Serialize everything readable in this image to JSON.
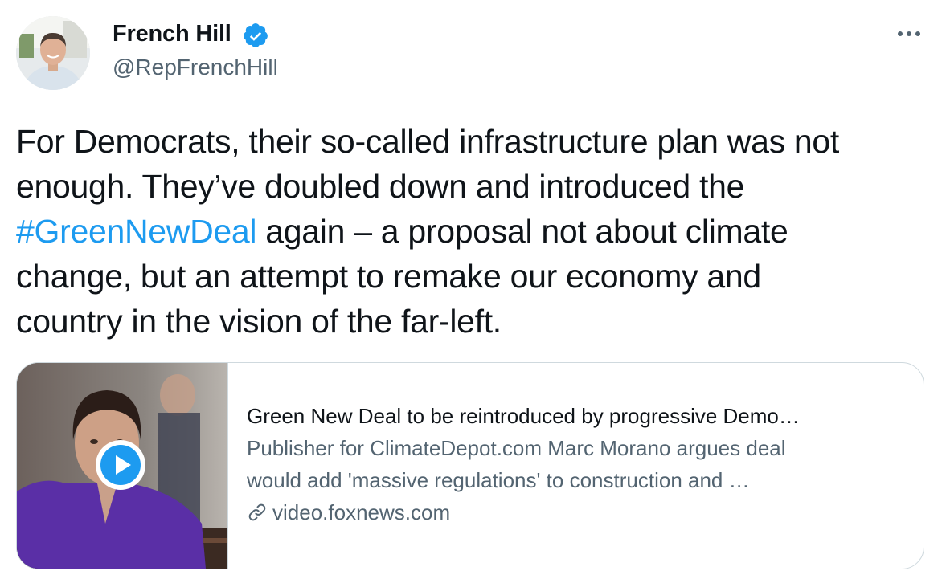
{
  "author": {
    "display_name": "French Hill",
    "handle": "@RepFrenchHill",
    "verified": true,
    "avatar_icon": "profile-photo"
  },
  "more_icon": "ellipsis-icon",
  "tweet": {
    "lines": [
      "For Democrats, their so-called infrastructure plan was not",
      "enough. They’ve doubled down and introduced the",
      "again – a proposal not about climate",
      "change, but an attempt to remake our economy and",
      "country in the vision of the far-left."
    ],
    "hashtag": "#GreenNewDeal"
  },
  "card": {
    "title": "Green New Deal to be reintroduced by progressive Demo…",
    "description_lines": [
      "Publisher for ClimateDepot.com Marc Morano argues deal",
      "would add 'massive regulations' to construction and …"
    ],
    "domain": "video.foxnews.com",
    "media_icon": "video-thumbnail",
    "play_icon": "play-icon",
    "link_icon": "link-icon"
  },
  "colors": {
    "text": "#0f1419",
    "secondary": "#536471",
    "accent": "#1d9bf0",
    "border": "#cfd9de"
  }
}
